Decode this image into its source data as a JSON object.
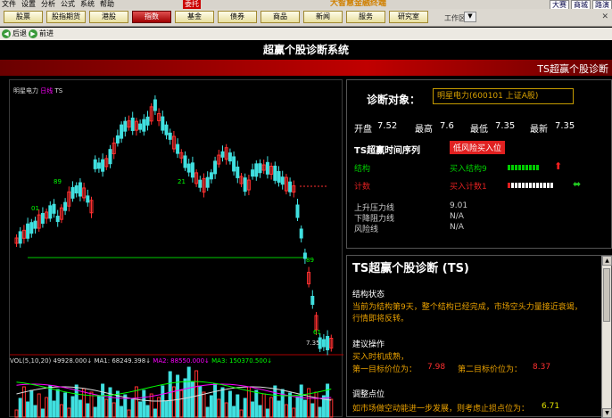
{
  "titlebar": {
    "menu": [
      "文件",
      "设置",
      "分析",
      "公式",
      "系统",
      "委托",
      "帮助"
    ],
    "badge": "委托",
    "brand": "大智慧金融终端",
    "right_links": [
      "大赛",
      "商城",
      "路演"
    ]
  },
  "navbar": {
    "buttons": [
      {
        "label": "股票"
      },
      {
        "label": "股指期货"
      },
      {
        "label": "港股"
      },
      {
        "label": "指数"
      },
      {
        "label": "基金"
      },
      {
        "label": "债券"
      },
      {
        "label": "商品"
      },
      {
        "label": "新闻"
      },
      {
        "label": "服务"
      },
      {
        "label": "研究室"
      }
    ],
    "active_index": 3,
    "workarea": "工作区",
    "workarea_drop": "▼",
    "close": "✕"
  },
  "browsebar": {
    "back": "后退",
    "forward": "前进"
  },
  "page": {
    "title": "超赢个股诊断系统",
    "ts_title": "TS超赢个股诊断"
  },
  "chart": {
    "stock_label": "明星电力",
    "period": "日线",
    "indicator": "TS",
    "vol_label": "VOL(5,10,20)",
    "vol_value": "49928.000↓",
    "ma1": "MA1: 68249.398↓",
    "ma2": "MA2: 88550.000↓",
    "ma3": "MA3: 150370.500↓",
    "price_label": "7.35",
    "annotations": [
      "89",
      "01",
      "21",
      "89",
      "61"
    ],
    "colors": {
      "up": "#ff3030",
      "down": "#40e0e0",
      "support": "#00cc00",
      "resist": "#ff3030"
    }
  },
  "info": {
    "diag_label": "诊断对象：",
    "stock": "明星电力(600101 上证A股)",
    "open_label": "开盘",
    "open": "7.52",
    "high_label": "最高",
    "high": "7.6",
    "low_label": "最低",
    "low": "7.35",
    "last_label": "最新",
    "last": "7.35",
    "seq_title": "TS超赢时间序列",
    "seq_badge": "低风险买入位",
    "structure_label": "结构",
    "structure_value": "买入结构9",
    "count_label": "计数",
    "count_value": "买入计数1",
    "upper_label": "上升压力线",
    "upper_value": "9.01",
    "lower_label": "下降阻力线",
    "lower_value": "N/A",
    "risk_label": "风险线",
    "risk_value": "N/A"
  },
  "diagnosis": {
    "title": "TS超赢个股诊断 (TS)",
    "struct_title": "结构状态",
    "struct_text1": "当前为结构第9天，整个结构已经完成，市场空头力量接近衰竭，",
    "struct_text2": "行情即将反转。",
    "advice_title": "建议操作",
    "advice_text": "买入时机成熟，",
    "target1_label": "第一目标价位为：",
    "target1": "7.98",
    "target2_label": "第二目标价位为：",
    "target2": "8.37",
    "adjust_title": "调整点位",
    "adjust_text": "如市场做空动能进一步发展，则考虑止损点位为：",
    "stop_loss": "6.71"
  }
}
